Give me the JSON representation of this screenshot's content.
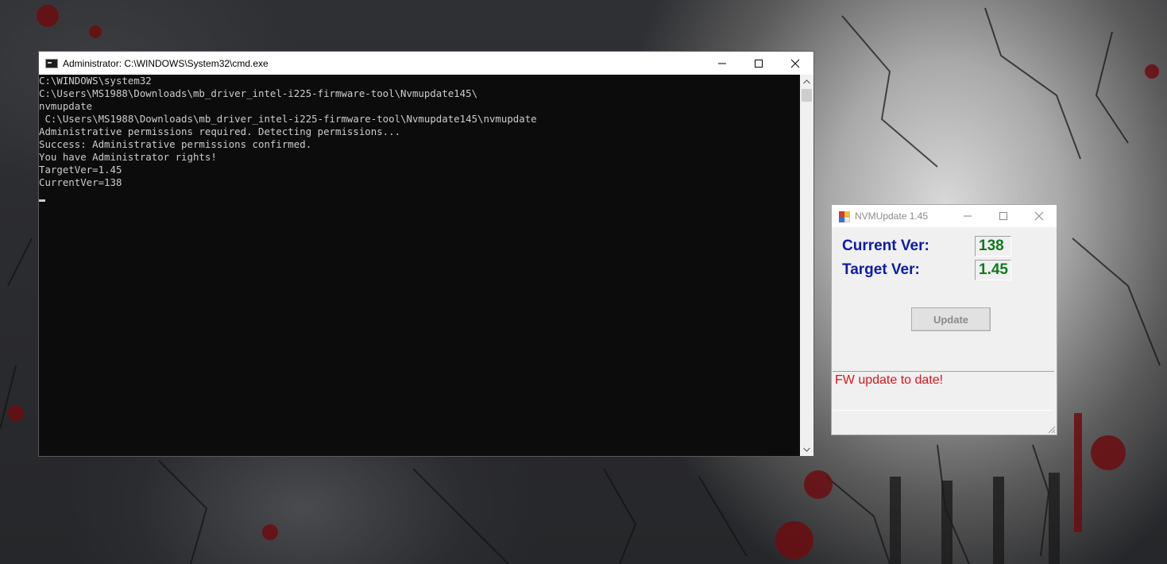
{
  "cmd_window": {
    "title": "Administrator: C:\\WINDOWS\\System32\\cmd.exe",
    "lines": [
      "C:\\WINDOWS\\system32",
      "C:\\Users\\MS1988\\Downloads\\mb_driver_intel-i225-firmware-tool\\Nvmupdate145\\",
      "nvmupdate",
      " C:\\Users\\MS1988\\Downloads\\mb_driver_intel-i225-firmware-tool\\Nvmupdate145\\nvmupdate",
      "Administrative permissions required. Detecting permissions...",
      "Success: Administrative permissions confirmed.",
      "You have Administrator rights!",
      "TargetVer=1.45",
      "CurrentVer=138"
    ],
    "icons": {
      "minimize": "minimize-icon",
      "maximize": "maximize-icon",
      "close": "close-icon"
    }
  },
  "nvm_window": {
    "title": "NVMUpdate 1.45",
    "current_label": "Current Ver:",
    "current_value": "138",
    "target_label": "Target Ver:",
    "target_value": "1.45",
    "update_button": "Update",
    "status": "FW update to date!",
    "colors": {
      "label": "#0d1ba8",
      "value": "#0f7a1c",
      "status": "#d9161c"
    }
  }
}
